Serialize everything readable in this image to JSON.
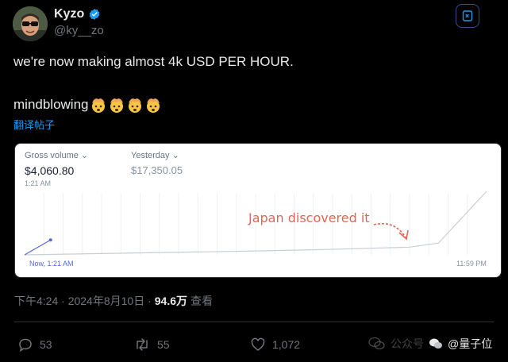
{
  "author": {
    "display_name": "Kyzo",
    "handle": "@ky__zo"
  },
  "tweet": {
    "line1": "we're now making almost 4k USD PER HOUR.",
    "line2": "mindblowing",
    "emoji_count": 4,
    "translate_label": "翻译帖子"
  },
  "card": {
    "metric1_label": "Gross volume",
    "metric1_value": "$4,060.80",
    "metric1_time": "1:21 AM",
    "metric2_label": "Yesterday",
    "metric2_value": "$17,350.05",
    "x_start_label": "Now, 1:21 AM",
    "x_end_label": "11:59 PM",
    "annotation": "Japan discovered it"
  },
  "meta": {
    "time": "下午4:24 · 2024年8月10日 ·",
    "views": "94.6万",
    "views_label": "查看"
  },
  "actions": {
    "replies": "53",
    "reposts": "55",
    "likes": "1,072"
  },
  "watermark": {
    "faded": "公众号",
    "text": "@量子位"
  },
  "colors": {
    "accent": "#1d9bf0",
    "annotation": "#e06652",
    "today_line": "#5469d4"
  },
  "chart_data": {
    "type": "line",
    "series": [
      {
        "values_note_free": true,
        "x": [
          0,
          1.35
        ],
        "y": [
          0,
          4060.8
        ]
      },
      {
        "x": [
          0,
          4,
          8,
          12,
          16,
          20,
          21.5,
          24
        ],
        "y": [
          0,
          350,
          700,
          1050,
          1500,
          2100,
          3200,
          17350.05
        ]
      }
    ]
  }
}
